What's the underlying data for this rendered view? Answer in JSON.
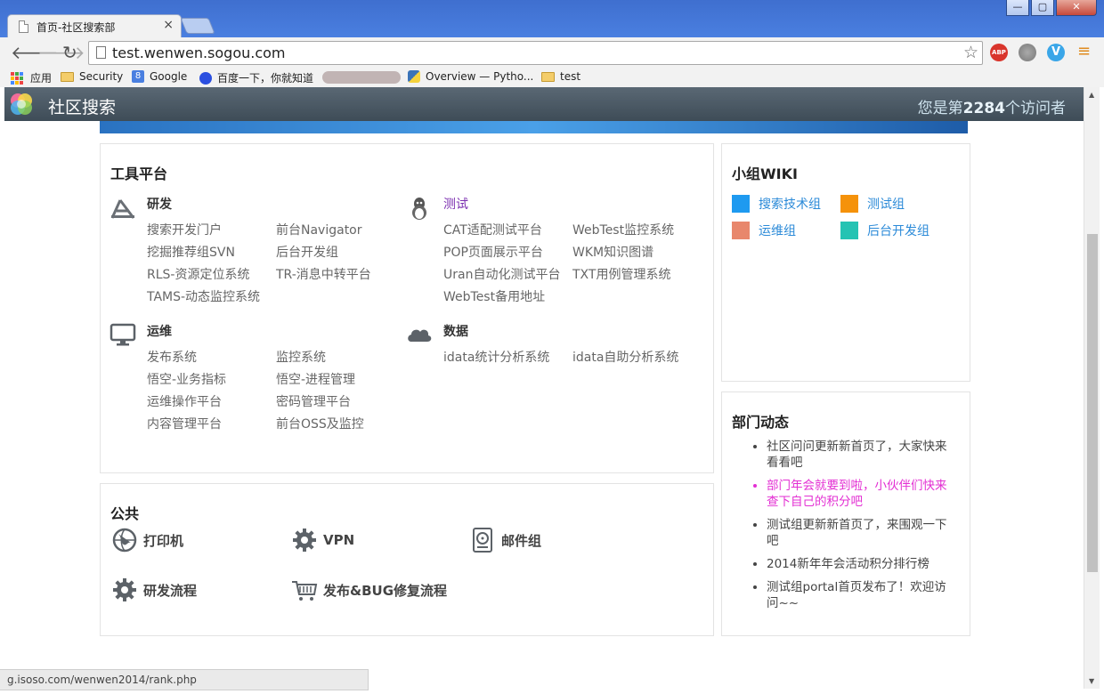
{
  "browser": {
    "tab_title": "首页-社区搜索部",
    "tab_close": "×",
    "url": "test.wenwen.sogou.com",
    "window_buttons": [
      "—",
      "▢",
      "✕"
    ],
    "bookmarks": [
      {
        "label": "应用",
        "icon": "apps-icon"
      },
      {
        "label": "Security",
        "icon": "folder-icon"
      },
      {
        "label": "Google",
        "icon": "google-icon"
      },
      {
        "label": "百度一下，你就知道",
        "icon": "baidu-icon"
      },
      {
        "label": "Overview — Pytho...",
        "icon": "python-icon"
      },
      {
        "label": "test",
        "icon": "folder-icon"
      }
    ],
    "extensions": [
      "adblock-icon",
      "globe-icon",
      "vimeo-icon",
      "menu-icon"
    ],
    "status_url": "g.isoso.com/wenwen2014/rank.php"
  },
  "header": {
    "site_title": "社区搜索",
    "visitor_prefix": "您是第",
    "visitor_count": "2284",
    "visitor_suffix": "个访问者"
  },
  "tools": {
    "title": "工具平台",
    "categories": [
      {
        "name": "研发",
        "icon": "appstore-icon",
        "links": [
          "搜索开发门户",
          "前台Navigator",
          "挖掘推荐组SVN",
          "后台开发组",
          "RLS-资源定位系统",
          "TR-消息中转平台",
          "TAMS-动态监控系统"
        ]
      },
      {
        "name": "测试",
        "icon": "linux-icon",
        "links": [
          "CAT适配测试平台",
          "WebTest监控系统",
          "POP页面展示平台",
          "WKM知识图谱",
          "Uran自动化测试平台",
          "TXT用例管理系统",
          "WebTest备用地址"
        ]
      },
      {
        "name": "运维",
        "icon": "monitor-icon",
        "links": [
          "发布系统",
          "监控系统",
          "悟空-业务指标",
          "悟空-进程管理",
          "运维操作平台",
          "密码管理平台",
          "内容管理平台",
          "前台OSS及监控"
        ]
      },
      {
        "name": "数据",
        "icon": "cloud-icon",
        "links": [
          "idata统计分析系统",
          "idata自助分析系统"
        ]
      }
    ]
  },
  "public": {
    "title": "公共",
    "items": [
      {
        "label": "打印机",
        "icon": "globe-icon"
      },
      {
        "label": "VPN",
        "icon": "gear-icon"
      },
      {
        "label": "邮件组",
        "icon": "harddisk-icon"
      },
      {
        "label": "研发流程",
        "icon": "gear-icon"
      },
      {
        "label": "发布&BUG修复流程",
        "icon": "cart-icon"
      }
    ]
  },
  "wiki": {
    "title": "小组WIKI",
    "groups": [
      {
        "label": "搜索技术组",
        "color": "#1e9af0"
      },
      {
        "label": "测试组",
        "color": "#f5920a"
      },
      {
        "label": "运维组",
        "color": "#e8876c"
      },
      {
        "label": "后台开发组",
        "color": "#25c3b3"
      }
    ]
  },
  "news": {
    "title": "部门动态",
    "items": [
      {
        "text": "社区问问更新新首页了，大家快来看看吧",
        "hot": false
      },
      {
        "text": "部门年会就要到啦，小伙伴们快来查下自己的积分吧",
        "hot": true
      },
      {
        "text": "测试组更新新首页了，来围观一下吧",
        "hot": false
      },
      {
        "text": "2014新年年会活动积分排行榜",
        "hot": false
      },
      {
        "text": "测试组portal首页发布了！欢迎访问~~",
        "hot": false
      }
    ]
  }
}
